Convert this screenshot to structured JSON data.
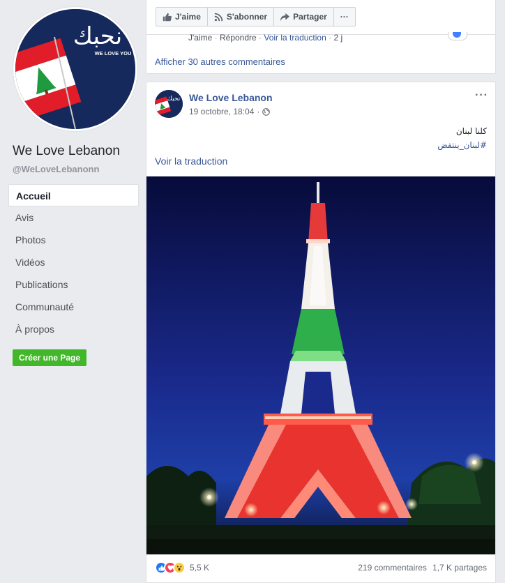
{
  "page": {
    "cover_text": "نحبك",
    "cover_subtext": "WE LOVE YOU",
    "name": "We Love Lebanon",
    "handle": "@WeLoveLebanonn"
  },
  "nav": {
    "items": [
      {
        "label": "Accueil"
      },
      {
        "label": "Avis"
      },
      {
        "label": "Photos"
      },
      {
        "label": "Vidéos"
      },
      {
        "label": "Publications"
      },
      {
        "label": "Communauté"
      },
      {
        "label": "À propos"
      }
    ],
    "create_page": "Créer une Page"
  },
  "action_bar": {
    "like": "J'aime",
    "subscribe": "S'abonner",
    "share": "Partager",
    "more": "···"
  },
  "prev_post": {
    "comment_like": "J'aime",
    "comment_reply": "Répondre",
    "comment_translate": "Voir la traduction",
    "comment_time": "2 j",
    "more_comments": "Afficher 30 autres commentaires"
  },
  "post": {
    "author": "We Love Lebanon",
    "date": "19 octobre, 18:04",
    "options": "···",
    "text": "كلنا لبنان",
    "hashtag": "#لبنان_ينتفض",
    "translate": "Voir la traduction",
    "reactions_count": "5,5 K",
    "comments": "219 commentaires",
    "shares": "1,7 K partages"
  },
  "colors": {
    "link": "#385898",
    "green_button": "#42b72a",
    "page_bg": "#e9ebee",
    "like_blue": "#2078f4",
    "love_red": "#f33e58",
    "wow_yellow": "#fccc48"
  },
  "icons": [
    "thumbs-up-icon",
    "rss-icon",
    "share-arrow-icon",
    "globe-icon",
    "like-reaction-icon",
    "love-reaction-icon",
    "wow-reaction-icon"
  ]
}
